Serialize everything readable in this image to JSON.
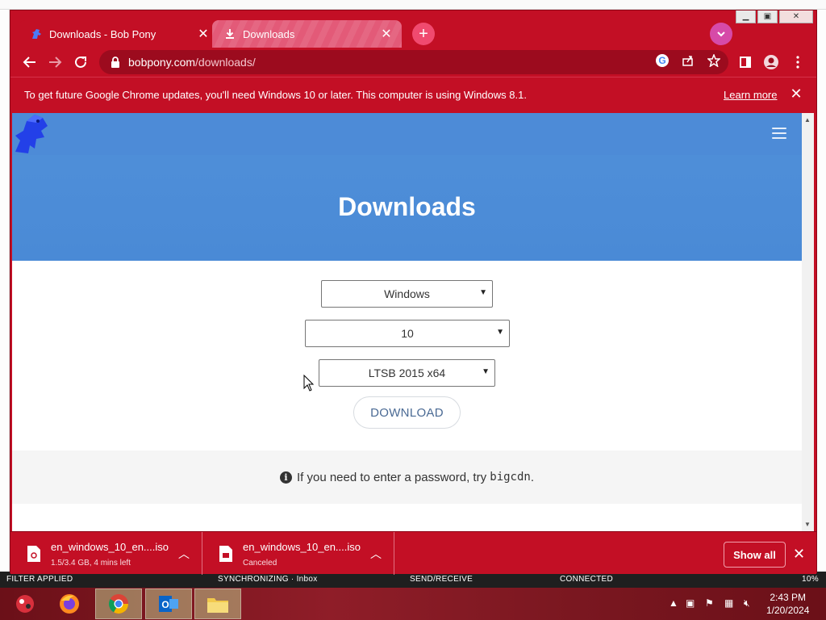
{
  "browser": {
    "tabs": [
      {
        "title": "Downloads - Bob Pony",
        "active": true,
        "favicon": "dinosaur-logo"
      },
      {
        "title": "Downloads",
        "active": false,
        "favicon": "download-icon"
      }
    ],
    "new_tab_symbol": "+",
    "url_host": "bobpony.com",
    "url_path": "/downloads/",
    "accent_color": "#c30f25"
  },
  "infobar": {
    "message": "To get future Google Chrome updates, you'll need Windows 10 or later. This computer is using Windows 8.1.",
    "link_label": "Learn more",
    "close_symbol": "✕"
  },
  "page": {
    "heading": "Downloads",
    "selects": {
      "os": "Windows",
      "version": "10",
      "edition": "LTSB 2015 x64"
    },
    "download_button": "DOWNLOAD",
    "note_prefix": "If you need to enter a password, try ",
    "note_code": "bigcdn",
    "note_suffix": ".",
    "hero_color": "#4a8ad6"
  },
  "downloads": [
    {
      "filename": "en_windows_10_en....iso",
      "status": "1.5/3.4 GB, 4 mins left"
    },
    {
      "filename": "en_windows_10_en....iso",
      "status": "Canceled"
    }
  ],
  "shelf": {
    "show_all": "Show all"
  },
  "taskbar": {
    "time": "2:43 PM",
    "date": "1/20/2024",
    "apps": [
      "game-icon",
      "firefox-icon",
      "chrome-icon",
      "outlook-icon",
      "file-explorer-icon"
    ]
  },
  "background_status": {
    "filter": "FILTER APPLIED",
    "sync": "SYNCHRONIZING · Inbox",
    "send_receive": "SEND/RECEIVE",
    "connected": "CONNECTED",
    "zoom": "10%"
  }
}
